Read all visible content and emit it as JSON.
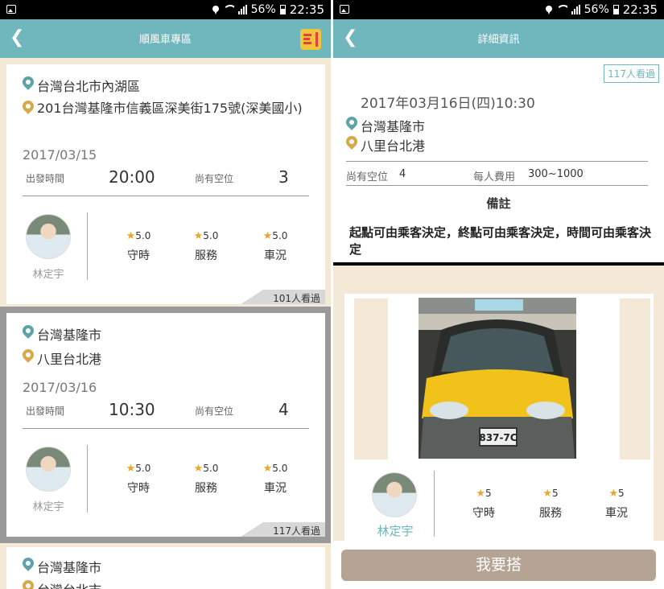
{
  "status_bar": {
    "battery": "56%",
    "time": "22:35"
  },
  "left": {
    "title": "順風車專區",
    "cards": [
      {
        "origin": "台灣台北市內湖區",
        "destination": "201台灣基隆市信義區深美街175號(深美國小)",
        "date": "2017/03/15",
        "depart_label": "出發時間",
        "depart_time": "20:00",
        "seats_label": "尚有空位",
        "seats": "3",
        "driver": "林定宇",
        "ratings": [
          {
            "score": "5.0",
            "label": "守時"
          },
          {
            "score": "5.0",
            "label": "服務"
          },
          {
            "score": "5.0",
            "label": "車況"
          }
        ],
        "views": "101人看過"
      },
      {
        "origin": "台灣基隆市",
        "destination": "八里台北港",
        "date": "2017/03/16",
        "depart_label": "出發時間",
        "depart_time": "10:30",
        "seats_label": "尚有空位",
        "seats": "4",
        "driver": "林定宇",
        "ratings": [
          {
            "score": "5.0",
            "label": "守時"
          },
          {
            "score": "5.0",
            "label": "服務"
          },
          {
            "score": "5.0",
            "label": "車況"
          }
        ],
        "views": "117人看過"
      },
      {
        "origin": "台灣基隆市",
        "destination": "台灣台北市"
      }
    ]
  },
  "right": {
    "title": "詳細資訊",
    "views": "117人看過",
    "datetime": "2017年03月16日(四)10:30",
    "origin": "台灣基隆市",
    "destination": "八里台北港",
    "seats_label": "尚有空位",
    "seats": "4",
    "fee_label": "每人費用",
    "fee": "300~1000",
    "notes_title": "備註",
    "notes": "起點可由乘客決定，終點可由乘客決定，時間可由乘客決定",
    "plate": "837-7C",
    "driver": "林定宇",
    "ratings": [
      {
        "score": "5",
        "label": "守時"
      },
      {
        "score": "5",
        "label": "服務"
      },
      {
        "score": "5",
        "label": "車況"
      }
    ],
    "ride_button": "我要搭"
  },
  "colors": {
    "appbar": "#6fb7bd",
    "background": "#f4e8d7",
    "button": "#b5a393",
    "origin_pin": "#5ea3a8",
    "destination_pin": "#d6a94a",
    "star": "#e6a82e"
  }
}
